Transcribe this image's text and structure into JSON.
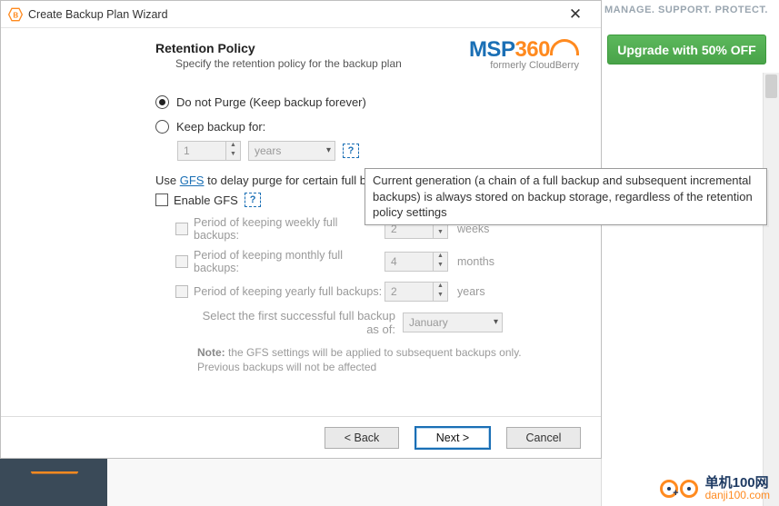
{
  "background": {
    "tagline": "MANAGE. SUPPORT. PROTECT.",
    "upgrade_button": "Upgrade with 50% OFF"
  },
  "wizard": {
    "title": "Create Backup Plan Wizard",
    "brand_primary": "MSP",
    "brand_secondary": "360",
    "brand_sub": "formerly CloudBerry",
    "section_heading": "Retention Policy",
    "section_sub": "Specify the retention policy for the backup plan",
    "radio": {
      "do_not_purge": "Do not Purge (Keep backup forever)",
      "keep_for": "Keep backup for:",
      "selected": "do_not_purge"
    },
    "keep_for_value": "1",
    "keep_for_unit": "years",
    "gfs_line_prefix": "Use ",
    "gfs_link": "GFS",
    "gfs_line_suffix": " to delay purge for certain full b",
    "enable_gfs": "Enable GFS",
    "gfs_rows": [
      {
        "label": "Period of keeping weekly full backups:",
        "value": "2",
        "unit": "weeks"
      },
      {
        "label": "Period of keeping monthly full backups:",
        "value": "4",
        "unit": "months"
      },
      {
        "label": "Period of keeping yearly full backups:",
        "value": "2",
        "unit": "years"
      }
    ],
    "select_first_label": "Select the first successful full backup as of:",
    "select_first_value": "January",
    "note_bold": "Note:",
    "note_text": " the GFS settings will be applied to subsequent backups only. Previous backups will not be affected",
    "footer": {
      "back": "< Back",
      "next": "Next >",
      "cancel": "Cancel"
    }
  },
  "tooltip": "Current generation (a chain of a full backup and subsequent incremental backups) is always stored on backup storage, regardless of the retention policy settings",
  "watermark": {
    "name": "单机100网",
    "url": "danji100.com"
  }
}
